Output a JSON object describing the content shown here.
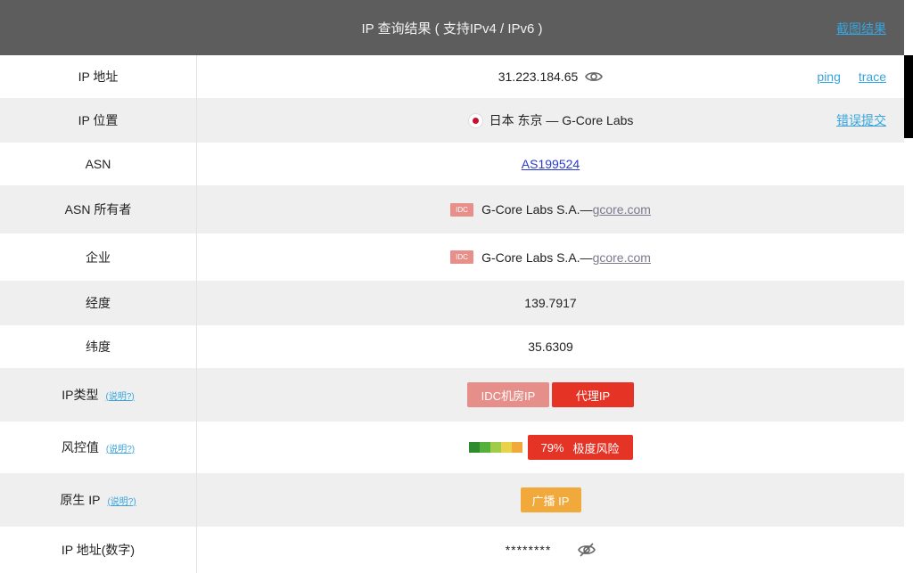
{
  "header": {
    "title": "IP 查询结果 ( 支持IPv4 / IPv6 )",
    "screenshot_link": "截图结果"
  },
  "rows": {
    "ip": {
      "label": "IP 地址",
      "value": "31.223.184.65",
      "icon": "eye-icon",
      "ping": "ping",
      "trace": "trace"
    },
    "location": {
      "label": "IP 位置",
      "flag": "japan-flag-icon",
      "value": "日本 东京 — G-Core Labs",
      "report": "错误提交"
    },
    "asn": {
      "label": "ASN",
      "value": "AS199524"
    },
    "asn_owner": {
      "label": "ASN 所有者",
      "badge": "IDC",
      "name": "G-Core Labs S.A.—",
      "domain": "gcore.com"
    },
    "company": {
      "label": "企业",
      "badge": "IDC",
      "name": "G-Core Labs S.A.—",
      "domain": "gcore.com"
    },
    "longitude": {
      "label": "经度",
      "value": "139.7917"
    },
    "latitude": {
      "label": "纬度",
      "value": "35.6309"
    },
    "ip_type": {
      "label": "IP类型",
      "note": "(说明?)",
      "tags": [
        "IDC机房IP",
        "代理IP"
      ]
    },
    "risk": {
      "label": "风控值",
      "note": "(说明?)",
      "value": "79%",
      "level": "极度风险",
      "bar_colors": [
        "#2e8b2e",
        "#55b13c",
        "#9fcd4a",
        "#e8d24a",
        "#f2a93b"
      ]
    },
    "native": {
      "label": "原生 IP",
      "note": "(说明?)",
      "tag": "广播 IP"
    },
    "ip_number": {
      "label": "IP 地址(数字)",
      "value": "********",
      "icon": "eye-slash-icon"
    }
  },
  "colors": {
    "header_bg": "#5d5d5d",
    "link": "#37a4dd",
    "danger": "#e53326",
    "idc": "#e68e8a",
    "broadcast": "#f2a93b",
    "row_alt": "#efefef"
  }
}
